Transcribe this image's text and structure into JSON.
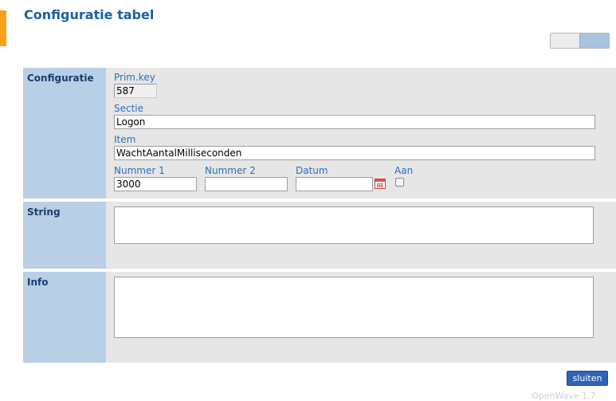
{
  "page": {
    "title": "Configuratie tabel"
  },
  "sections": {
    "configuratie": {
      "label": "Configuratie",
      "prim_key": {
        "label": "Prim.key",
        "value": "587"
      },
      "sectie": {
        "label": "Sectie",
        "value": "Logon"
      },
      "item": {
        "label": "Item",
        "value": "WachtAantalMilliseconden"
      },
      "nummer1": {
        "label": "Nummer 1",
        "value": "3000"
      },
      "nummer2": {
        "label": "Nummer 2",
        "value": ""
      },
      "datum": {
        "label": "Datum",
        "value": ""
      },
      "aan": {
        "label": "Aan",
        "checked": false
      }
    },
    "string": {
      "label": "String",
      "value": ""
    },
    "info": {
      "label": "Info",
      "value": ""
    }
  },
  "actions": {
    "close_label": "sluiten"
  },
  "footer": {
    "version": "OpenWave 1.7"
  },
  "colors": {
    "accent": "#f7a21b",
    "title": "#1a5fa8",
    "label_band": "#b8cfe6",
    "body_bg": "#e6e6e6",
    "button": "#2f63b5"
  }
}
